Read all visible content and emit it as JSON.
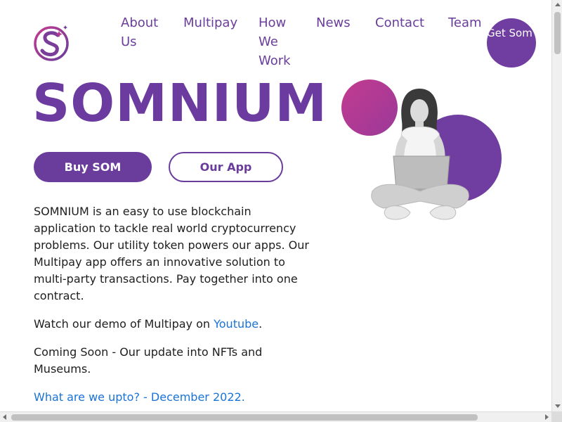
{
  "brand": {
    "logo_icon": "somnium-s-planet-icon",
    "accent": "#6b3b9f",
    "link_color": "#1a73d6",
    "magenta": "#b23a8f"
  },
  "nav": {
    "about": "About Us",
    "multipay": "Multipay",
    "how": "How We Work",
    "news": "News",
    "contact": "Contact",
    "team": "Team",
    "get_som": "Get Som"
  },
  "hero": {
    "title": "SOMNIUM",
    "buy_button": "Buy SOM",
    "app_button": "Our App",
    "illustration_icon": "woman-with-laptop-illustration"
  },
  "content": {
    "intro": "SOMNIUM is an easy to use blockchain application to tackle real world cryptocurrency problems. Our utility token powers our apps. Our Multipay app offers an innovative solution to multi-party transactions. Pay together into one contract.",
    "demo_prefix": "Watch our demo of Multipay on ",
    "demo_link": "Youtube",
    "demo_suffix": ".",
    "coming_soon": "Coming Soon - Our update into NFTs and Museums.",
    "update_link": "What are we upto? - December 2022."
  }
}
